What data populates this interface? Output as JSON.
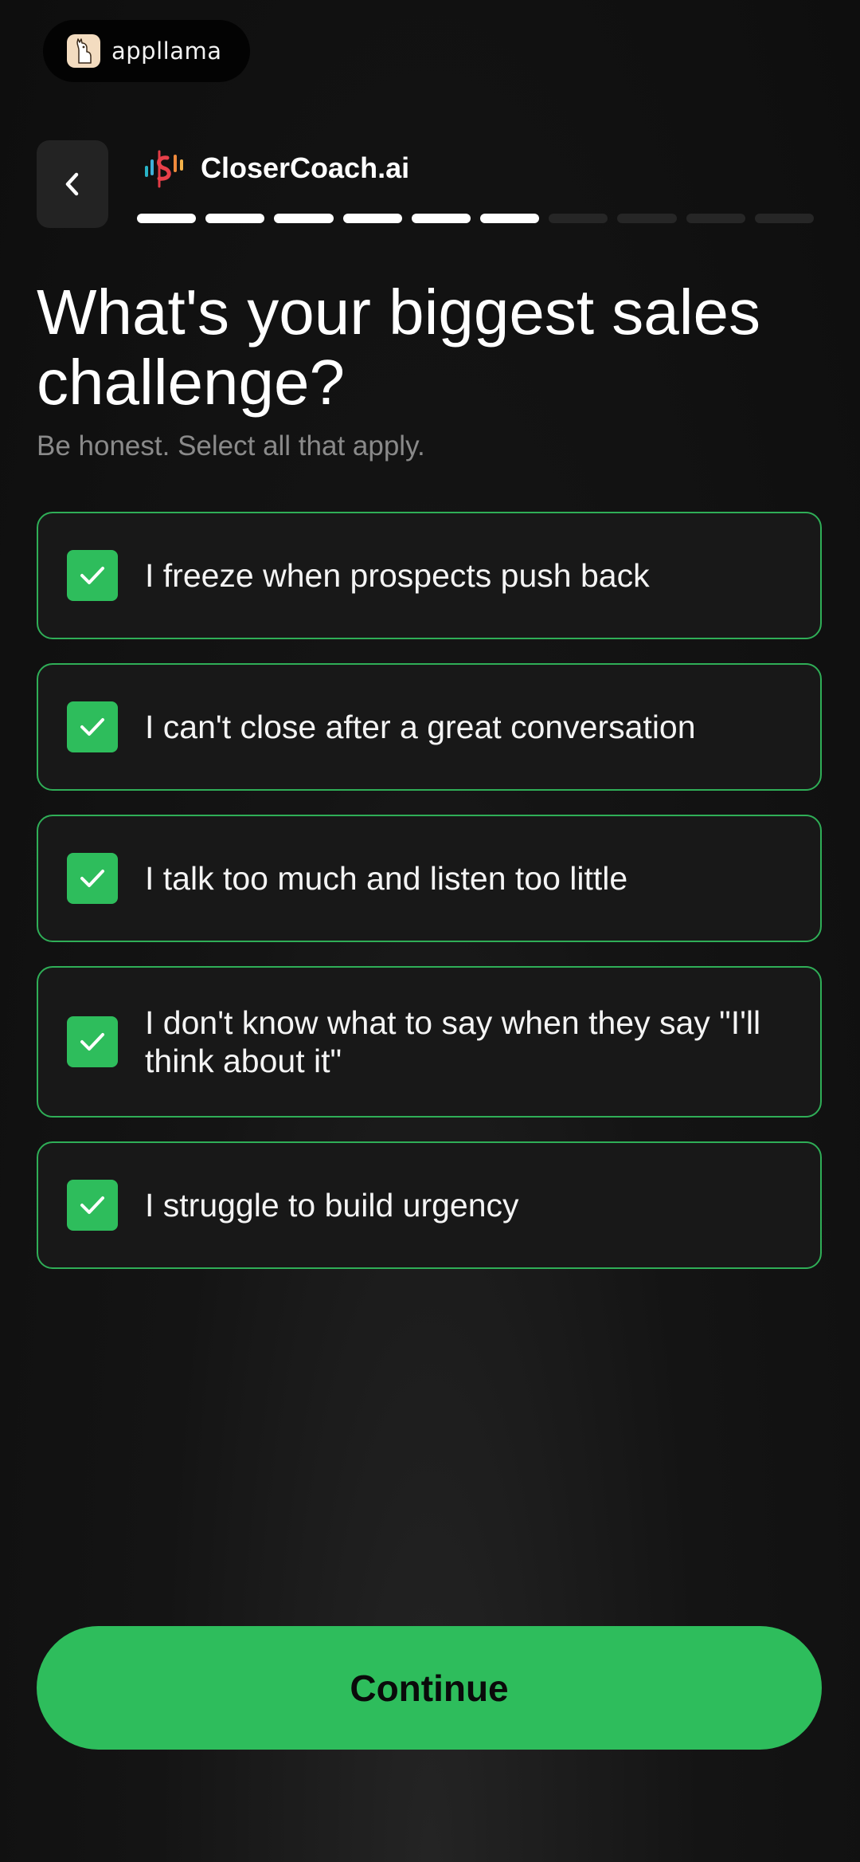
{
  "badge": {
    "icon": "llama-icon",
    "text": "appllama"
  },
  "header": {
    "back_icon": "chevron-left-icon",
    "app_logo_icon": "closer-coach-logo-icon",
    "app_name": "CloserCoach.ai",
    "progress": {
      "completed_steps": 6,
      "total_steps": 10
    }
  },
  "question": {
    "title": "What's your biggest sales challenge?",
    "subtitle": "Be honest. Select all that apply."
  },
  "options": [
    {
      "label": "I freeze when prospects push back",
      "checked": true
    },
    {
      "label": "I can't close after a great conversation",
      "checked": true
    },
    {
      "label": "I talk too much and listen too little",
      "checked": true
    },
    {
      "label": "I don't know what to say when they say \"I'll think about it\"",
      "checked": true
    },
    {
      "label": "I struggle to build urgency",
      "checked": true
    }
  ],
  "footer": {
    "continue_label": "Continue"
  },
  "colors": {
    "accent": "#2ebd5c",
    "border": "#2fae57",
    "background": "#121212",
    "card": "#181818",
    "subtitle": "#8a8a8a"
  }
}
